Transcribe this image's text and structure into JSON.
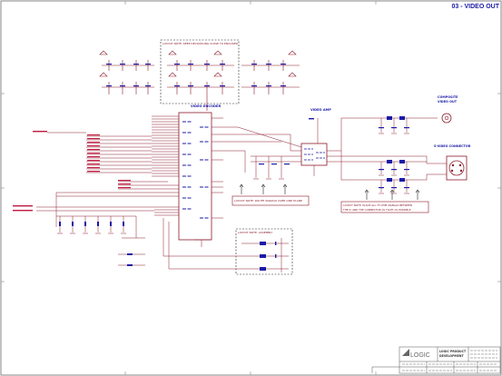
{
  "sheet": {
    "title": "03 - VIDEO OUT"
  },
  "blocks": {
    "video_encoder": "VIDEO ENCODER",
    "video_amp": "VIDEO AMP",
    "composite": [
      "COMPOSITE",
      "VIDEO OUT"
    ],
    "svideo": "S-VIDEO CONNECTOR"
  },
  "notes": {
    "top_box": "LAYOUT NOTE: KEEP DECOUPLING CLOSE TO ENCODER",
    "left_box": "LAYOUT NOTE: ROUTE SIGNALS OVER GND PLANE",
    "bottom_box": "LAYOUT NOTE: ASSEMBLY",
    "right_box": [
      "LAYOUT NOTE: PLACE ALL 75 OHM SIGNALS BETWEEN",
      "THE IC AND THE CONNECTOR AS TIGHT AS POSSIBLE"
    ]
  },
  "title_block": {
    "company": "LOGIC",
    "line1": "LOGIC PRODUCT",
    "line2": "DEVELOPMENT"
  },
  "colors": {
    "wire": "#8a1a2a",
    "text": "#1a1aa8",
    "frame": "#555555"
  }
}
